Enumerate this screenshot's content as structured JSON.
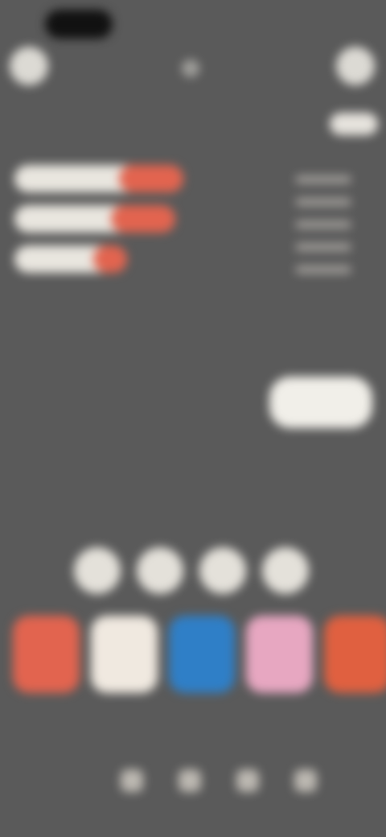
{
  "app": {
    "title": "",
    "status": ""
  },
  "header": {
    "page_title": "",
    "top_right_label": ""
  },
  "bars": {
    "items": [
      {
        "label": "",
        "fill_pct": 38
      },
      {
        "label": "",
        "fill_pct": 40
      },
      {
        "label": "",
        "fill_pct": 30
      }
    ],
    "caption": ""
  },
  "right_panel": {
    "primary_button_label": ""
  },
  "quick_actions": [
    {
      "name": "action-1"
    },
    {
      "name": "action-2"
    },
    {
      "name": "action-3"
    },
    {
      "name": "action-4"
    }
  ],
  "tiles": [
    {
      "label": "",
      "color": "#e2644f"
    },
    {
      "label": "",
      "color": "#f0e9e0"
    },
    {
      "label": "",
      "color": "#2f7fc7"
    },
    {
      "label": "",
      "color": "#e7a7c1"
    },
    {
      "label": "",
      "color": "#e06040"
    }
  ],
  "dock": {
    "items": [
      {
        "label": ""
      },
      {
        "label": ""
      },
      {
        "label": ""
      },
      {
        "label": ""
      }
    ]
  }
}
